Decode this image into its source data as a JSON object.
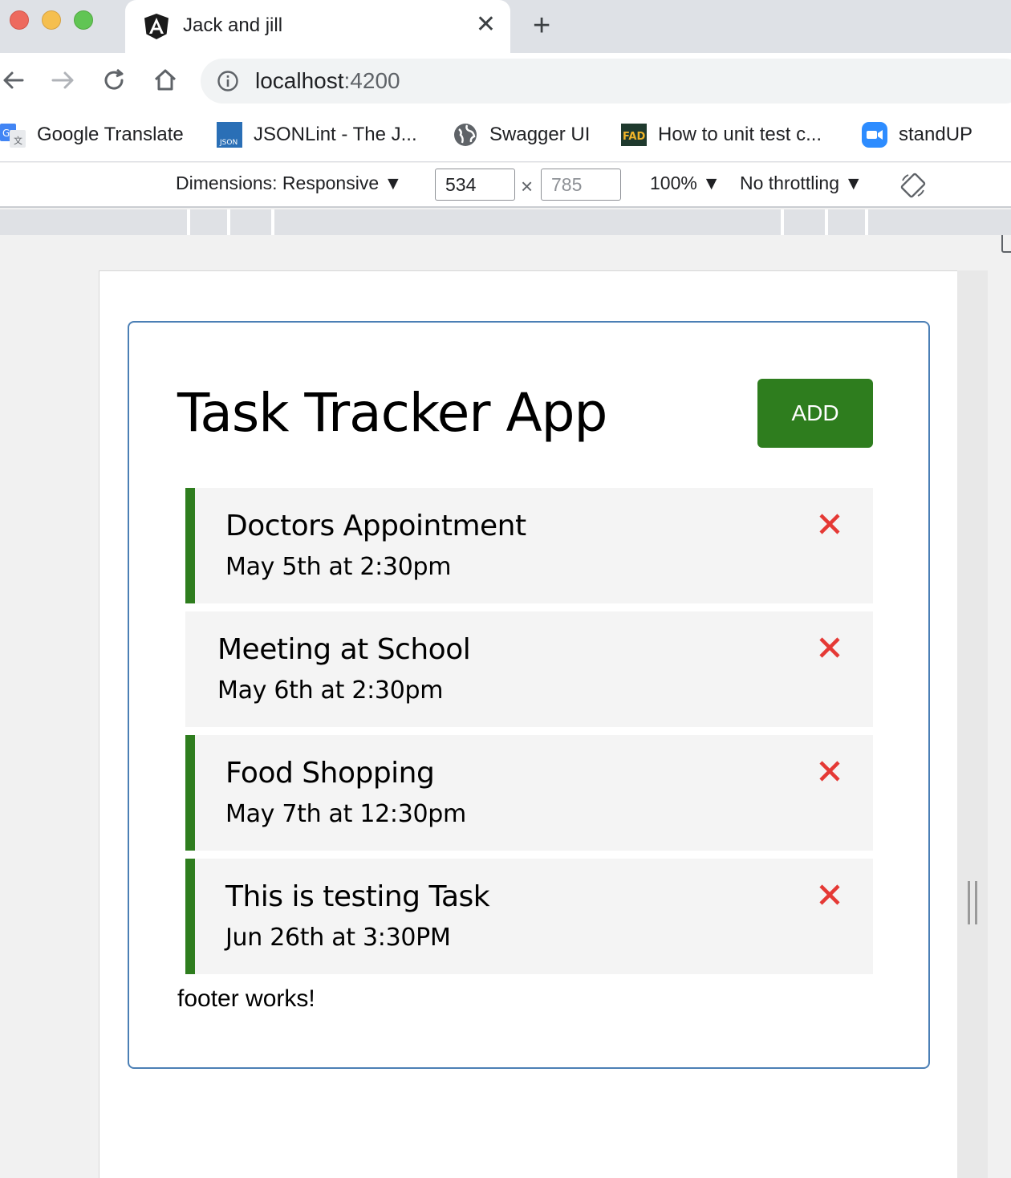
{
  "browser": {
    "tab": {
      "title": "Jack and jill"
    },
    "omnibox": {
      "host": "localhost",
      "port": ":4200"
    },
    "bookmarks": [
      {
        "label": "Google Translate",
        "icon": "google-translate-icon"
      },
      {
        "label": "JSONLint - The J...",
        "icon": "json-icon"
      },
      {
        "label": "Swagger UI",
        "icon": "globe-icon"
      },
      {
        "label": "How to unit test c...",
        "icon": "fad-icon"
      },
      {
        "label": "standUP",
        "icon": "zoom-camera-icon"
      }
    ]
  },
  "devtools": {
    "dimensions_label": "Dimensions: Responsive",
    "width": "534",
    "height": "785",
    "times": "×",
    "zoom": "100%",
    "throttling": "No throttling"
  },
  "app": {
    "title": "Task Tracker App",
    "add_label": "ADD",
    "tasks": [
      {
        "text": "Doctors Appointment",
        "day": "May 5th at 2:30pm",
        "reminder": true
      },
      {
        "text": "Meeting at School",
        "day": "May 6th at 2:30pm",
        "reminder": false
      },
      {
        "text": "Food Shopping",
        "day": "May 7th at 12:30pm",
        "reminder": true
      },
      {
        "text": "This is testing Task",
        "day": "Jun 26th at 3:30PM",
        "reminder": true
      }
    ],
    "footer": "footer works!"
  },
  "colors": {
    "accent_green": "#2e7d1e",
    "delete_red": "#e53935",
    "container_border": "#4b7fb5"
  }
}
